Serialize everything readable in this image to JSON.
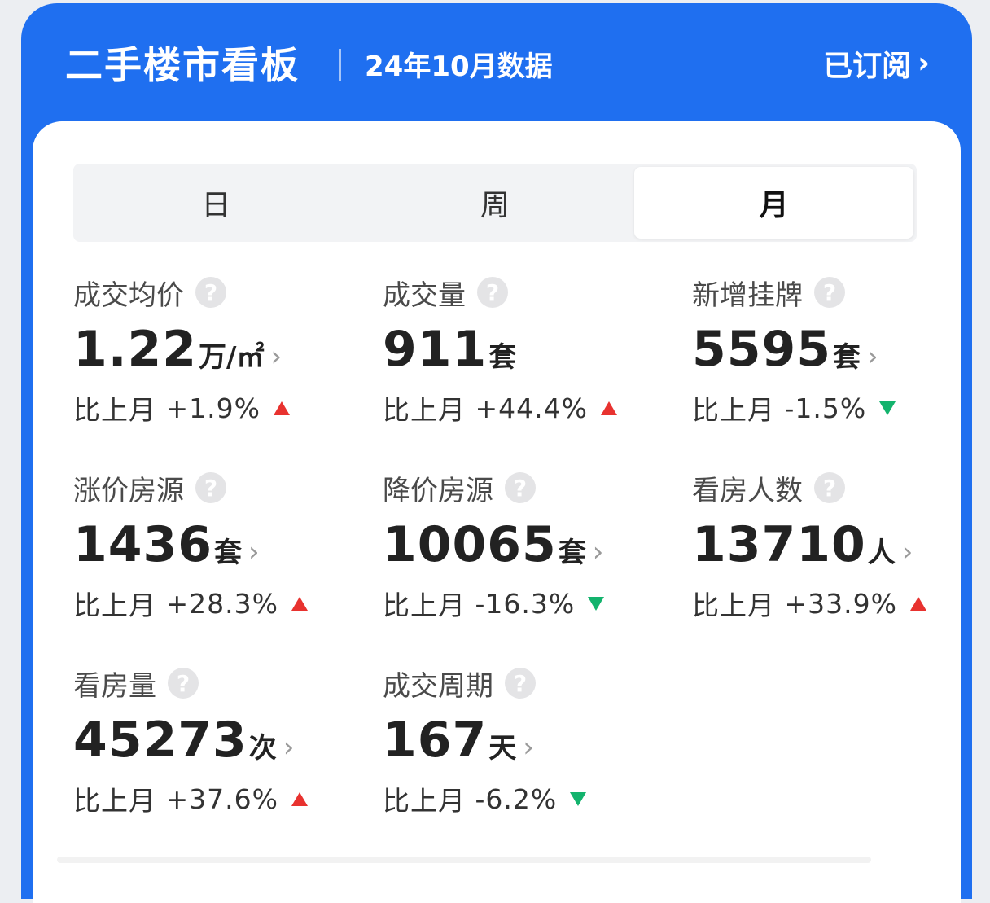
{
  "header": {
    "title": "二手楼市看板",
    "subtitle": "24年10月数据",
    "subscribe_label": "已订阅",
    "chevron": "›"
  },
  "tabs": [
    {
      "label": "日",
      "active": false
    },
    {
      "label": "周",
      "active": false
    },
    {
      "label": "月",
      "active": true
    }
  ],
  "metrics": [
    {
      "label": "成交均价",
      "value": "1.22",
      "unit": "万/㎡",
      "change_prefix": "比上月",
      "change": "+1.9%",
      "direction": "up"
    },
    {
      "label": "成交量",
      "value": "911",
      "unit": "套",
      "change_prefix": "比上月",
      "change": "+44.4%",
      "direction": "up"
    },
    {
      "label": "新增挂牌",
      "value": "5595",
      "unit": "套",
      "change_prefix": "比上月",
      "change": "-1.5%",
      "direction": "down"
    },
    {
      "label": "涨价房源",
      "value": "1436",
      "unit": "套",
      "change_prefix": "比上月",
      "change": "+28.3%",
      "direction": "up"
    },
    {
      "label": "降价房源",
      "value": "10065",
      "unit": "套",
      "change_prefix": "比上月",
      "change": "-16.3%",
      "direction": "down"
    },
    {
      "label": "看房人数",
      "value": "13710",
      "unit": "人",
      "change_prefix": "比上月",
      "change": "+33.9%",
      "direction": "up"
    },
    {
      "label": "看房量",
      "value": "45273",
      "unit": "次",
      "change_prefix": "比上月",
      "change": "+37.6%",
      "direction": "up"
    },
    {
      "label": "成交周期",
      "value": "167",
      "unit": "天",
      "change_prefix": "比上月",
      "change": "-6.2%",
      "direction": "down"
    }
  ],
  "icons": {
    "help": "?",
    "arrow": "›"
  },
  "colors": {
    "brand": "#1f6ff0",
    "up": "#e8322f",
    "down": "#13b36d"
  }
}
